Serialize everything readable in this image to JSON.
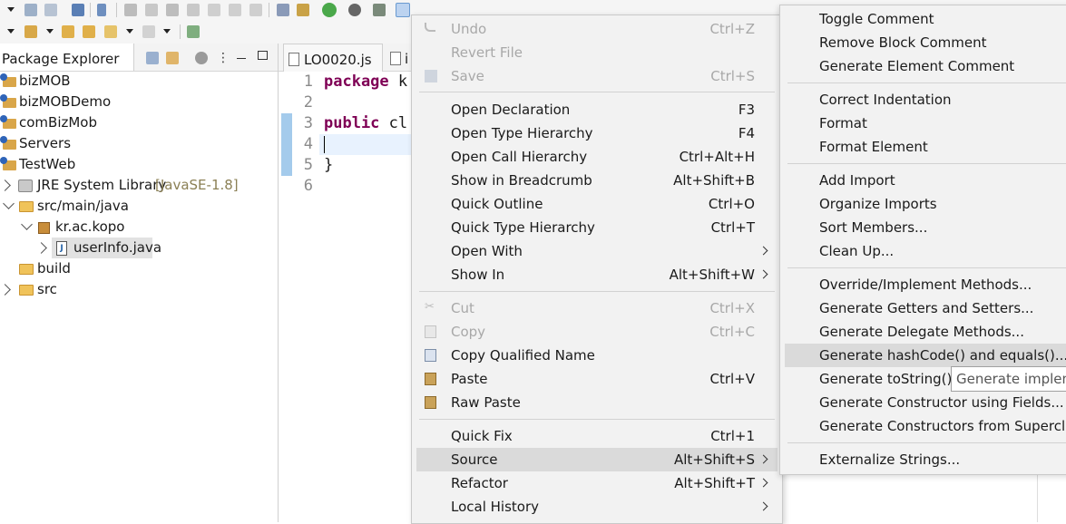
{
  "explorer": {
    "tab_label": "Package Explorer",
    "items": [
      {
        "label": "bizMOB"
      },
      {
        "label": "bizMOBDemo"
      },
      {
        "label": "comBizMob"
      },
      {
        "label": "Servers"
      },
      {
        "label": "TestWeb"
      },
      {
        "label": "JRE System Library",
        "suffix": "[JavaSE-1.8]"
      },
      {
        "label": "src/main/java"
      },
      {
        "label": "kr.ac.kopo"
      },
      {
        "label": "userInfo.java"
      },
      {
        "label": "build"
      },
      {
        "label": "src"
      }
    ]
  },
  "editor": {
    "tabs": [
      {
        "label": "LO0020.js"
      },
      {
        "label": "i"
      }
    ],
    "line_numbers": [
      "1",
      "2",
      "3",
      "4",
      "5",
      "6"
    ],
    "lines": [
      {
        "kw": "package",
        "rest": " k"
      },
      {
        "kw": "",
        "rest": ""
      },
      {
        "kw": "public",
        "rest": " cl"
      },
      {
        "kw": "",
        "rest": ""
      },
      {
        "kw": "",
        "rest": "}"
      },
      {
        "kw": "",
        "rest": ""
      }
    ]
  },
  "context_menu": {
    "items": [
      {
        "label": "Undo",
        "shortcut": "Ctrl+Z"
      },
      {
        "label": "Revert File",
        "shortcut": ""
      },
      {
        "label": "Save",
        "shortcut": "Ctrl+S"
      },
      {
        "label": "Open Declaration",
        "shortcut": "F3"
      },
      {
        "label": "Open Type Hierarchy",
        "shortcut": "F4"
      },
      {
        "label": "Open Call Hierarchy",
        "shortcut": "Ctrl+Alt+H"
      },
      {
        "label": "Show in Breadcrumb",
        "shortcut": "Alt+Shift+B"
      },
      {
        "label": "Quick Outline",
        "shortcut": "Ctrl+O"
      },
      {
        "label": "Quick Type Hierarchy",
        "shortcut": "Ctrl+T"
      },
      {
        "label": "Open With",
        "shortcut": ""
      },
      {
        "label": "Show In",
        "shortcut": "Alt+Shift+W"
      },
      {
        "label": "Cut",
        "shortcut": "Ctrl+X"
      },
      {
        "label": "Copy",
        "shortcut": "Ctrl+C"
      },
      {
        "label": "Copy Qualified Name",
        "shortcut": ""
      },
      {
        "label": "Paste",
        "shortcut": "Ctrl+V"
      },
      {
        "label": "Raw Paste",
        "shortcut": ""
      },
      {
        "label": "Quick Fix",
        "shortcut": "Ctrl+1"
      },
      {
        "label": "Source",
        "shortcut": "Alt+Shift+S"
      },
      {
        "label": "Refactor",
        "shortcut": "Alt+Shift+T"
      },
      {
        "label": "Local History",
        "shortcut": ""
      }
    ]
  },
  "source_submenu": {
    "items": [
      {
        "label": "Toggle Comment"
      },
      {
        "label": "Remove Block Comment"
      },
      {
        "label": "Generate Element Comment"
      },
      {
        "label": "Correct Indentation"
      },
      {
        "label": "Format"
      },
      {
        "label": "Format Element"
      },
      {
        "label": "Add Import"
      },
      {
        "label": "Organize Imports"
      },
      {
        "label": "Sort Members..."
      },
      {
        "label": "Clean Up..."
      },
      {
        "label": "Override/Implement Methods..."
      },
      {
        "label": "Generate Getters and Setters..."
      },
      {
        "label": "Generate Delegate Methods..."
      },
      {
        "label": "Generate hashCode() and equals()..."
      },
      {
        "label": "Generate toString()..."
      },
      {
        "label": "Generate Constructor using Fields..."
      },
      {
        "label": "Generate Constructors from Superclass..."
      },
      {
        "label": "Externalize Strings..."
      }
    ]
  },
  "tooltip": {
    "text": "Generate impleme"
  }
}
